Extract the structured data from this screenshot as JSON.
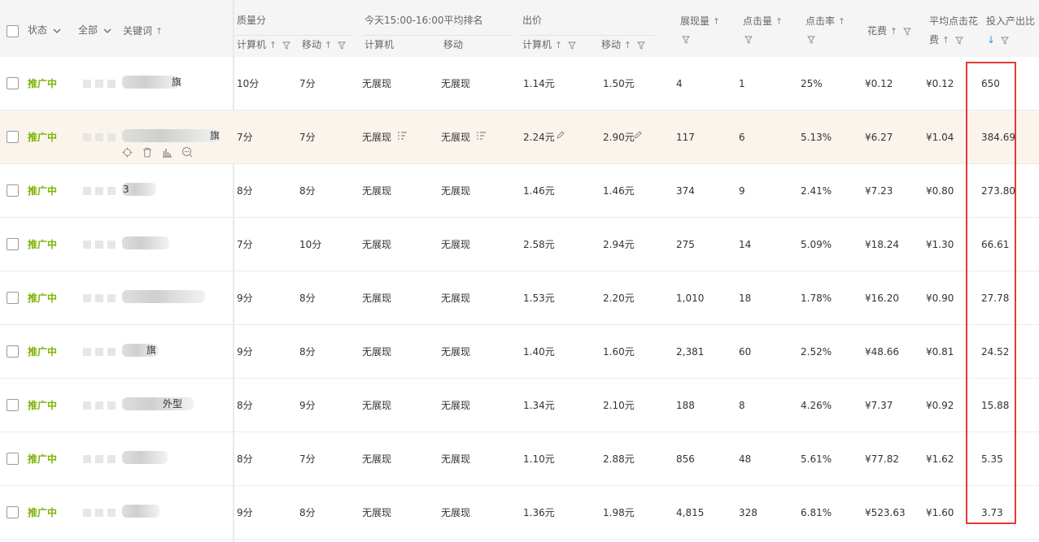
{
  "header": {
    "status_label": "状态",
    "all_label": "全部",
    "keyword_label": "关键词",
    "quality_group": "质量分",
    "quality_pc": "计算机",
    "quality_mobile": "移动",
    "rank_group": "今天15:00-16:00平均排名",
    "rank_pc": "计算机",
    "rank_mobile": "移动",
    "bid_group": "出价",
    "bid_pc": "计算机",
    "bid_mobile": "移动",
    "impressions": "展现量",
    "clicks": "点击量",
    "ctr": "点击率",
    "cost": "花费",
    "avg_cpc_line1": "平均点击花",
    "avg_cpc_line2": "费",
    "roi": "投入产出比"
  },
  "rows": [
    {
      "status": "推广中",
      "kw_tail": "旗",
      "q_pc": "10分",
      "q_m": "7分",
      "r_pc": "无展现",
      "r_m": "无展现",
      "b_pc": "1.14元",
      "b_m": "1.50元",
      "imp": "4",
      "clk": "1",
      "ctr": "25%",
      "cost": "¥0.12",
      "cpc": "¥0.12",
      "roi": "650"
    },
    {
      "status": "推广中",
      "kw_tail": "旗",
      "q_pc": "7分",
      "q_m": "7分",
      "r_pc": "无展现",
      "r_m": "无展现",
      "b_pc": "2.24元",
      "b_m": "2.90元",
      "imp": "117",
      "clk": "6",
      "ctr": "5.13%",
      "cost": "¥6.27",
      "cpc": "¥1.04",
      "roi": "384.69"
    },
    {
      "status": "推广中",
      "kw_tail": "3",
      "q_pc": "8分",
      "q_m": "8分",
      "r_pc": "无展现",
      "r_m": "无展现",
      "b_pc": "1.46元",
      "b_m": "1.46元",
      "imp": "374",
      "clk": "9",
      "ctr": "2.41%",
      "cost": "¥7.23",
      "cpc": "¥0.80",
      "roi": "273.80"
    },
    {
      "status": "推广中",
      "kw_tail": "",
      "q_pc": "7分",
      "q_m": "10分",
      "r_pc": "无展现",
      "r_m": "无展现",
      "b_pc": "2.58元",
      "b_m": "2.94元",
      "imp": "275",
      "clk": "14",
      "ctr": "5.09%",
      "cost": "¥18.24",
      "cpc": "¥1.30",
      "roi": "66.61"
    },
    {
      "status": "推广中",
      "kw_tail": "",
      "q_pc": "9分",
      "q_m": "8分",
      "r_pc": "无展现",
      "r_m": "无展现",
      "b_pc": "1.53元",
      "b_m": "2.20元",
      "imp": "1,010",
      "clk": "18",
      "ctr": "1.78%",
      "cost": "¥16.20",
      "cpc": "¥0.90",
      "roi": "27.78"
    },
    {
      "status": "推广中",
      "kw_tail": "旗",
      "q_pc": "9分",
      "q_m": "8分",
      "r_pc": "无展现",
      "r_m": "无展现",
      "b_pc": "1.40元",
      "b_m": "1.60元",
      "imp": "2,381",
      "clk": "60",
      "ctr": "2.52%",
      "cost": "¥48.66",
      "cpc": "¥0.81",
      "roi": "24.52"
    },
    {
      "status": "推广中",
      "kw_tail": "外型",
      "q_pc": "8分",
      "q_m": "9分",
      "r_pc": "无展现",
      "r_m": "无展现",
      "b_pc": "1.34元",
      "b_m": "2.10元",
      "imp": "188",
      "clk": "8",
      "ctr": "4.26%",
      "cost": "¥7.37",
      "cpc": "¥0.92",
      "roi": "15.88"
    },
    {
      "status": "推广中",
      "kw_tail": "",
      "q_pc": "8分",
      "q_m": "7分",
      "r_pc": "无展现",
      "r_m": "无展现",
      "b_pc": "1.10元",
      "b_m": "2.88元",
      "imp": "856",
      "clk": "48",
      "ctr": "5.61%",
      "cost": "¥77.82",
      "cpc": "¥1.62",
      "roi": "5.35"
    },
    {
      "status": "推广中",
      "kw_tail": "",
      "q_pc": "9分",
      "q_m": "8分",
      "r_pc": "无展现",
      "r_m": "无展现",
      "b_pc": "1.36元",
      "b_m": "1.98元",
      "imp": "4,815",
      "clk": "328",
      "ctr": "6.81%",
      "cost": "¥523.63",
      "cpc": "¥1.60",
      "roi": "3.73"
    }
  ],
  "colors": {
    "status_active": "#7cb305",
    "highlight_row": "#fbf4ec",
    "annotation_box": "#e53935",
    "sort_active": "#3a8ee6"
  }
}
